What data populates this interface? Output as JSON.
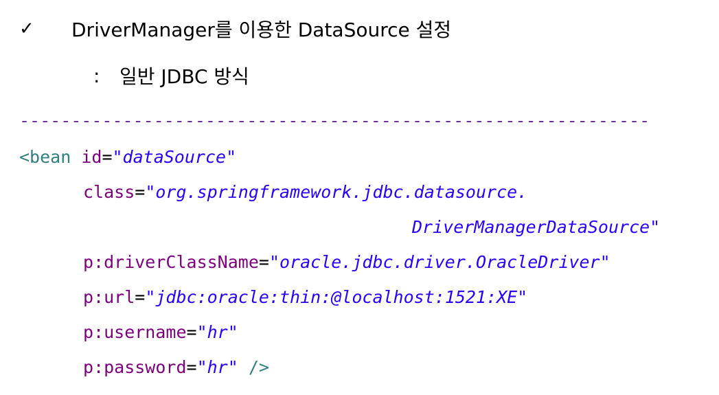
{
  "heading": {
    "checkmark": "✓",
    "title": "DriverManager를 이용한 DataSource 설정"
  },
  "subheading": {
    "colon": ":",
    "text": "일반 JDBC 방식"
  },
  "divider": "-------------------------------------------------------------",
  "code": {
    "bean_open": "<bean",
    "id_attr": "id",
    "eq": "=",
    "id_value": "\"dataSource\"",
    "class_attr": "class",
    "class_value_part1": "\"org.springframework.jdbc.datasource.",
    "class_value_part2": "DriverManagerDataSource\"",
    "driver_attr": "p:driverClassName",
    "driver_value": "\"oracle.jdbc.driver.OracleDriver\"",
    "url_attr": "p:url",
    "url_value": "\"jdbc:oracle:thin:@localhost:1521:XE\"",
    "username_attr": "p:username",
    "username_value": "\"hr\"",
    "password_attr": "p:password",
    "password_value": "\"hr\"",
    "bean_close": "/>"
  },
  "colors": {
    "tag": "#2e7f7f",
    "attribute": "#7f007f",
    "value": "#2a00ff",
    "divider": "#7030a0"
  }
}
